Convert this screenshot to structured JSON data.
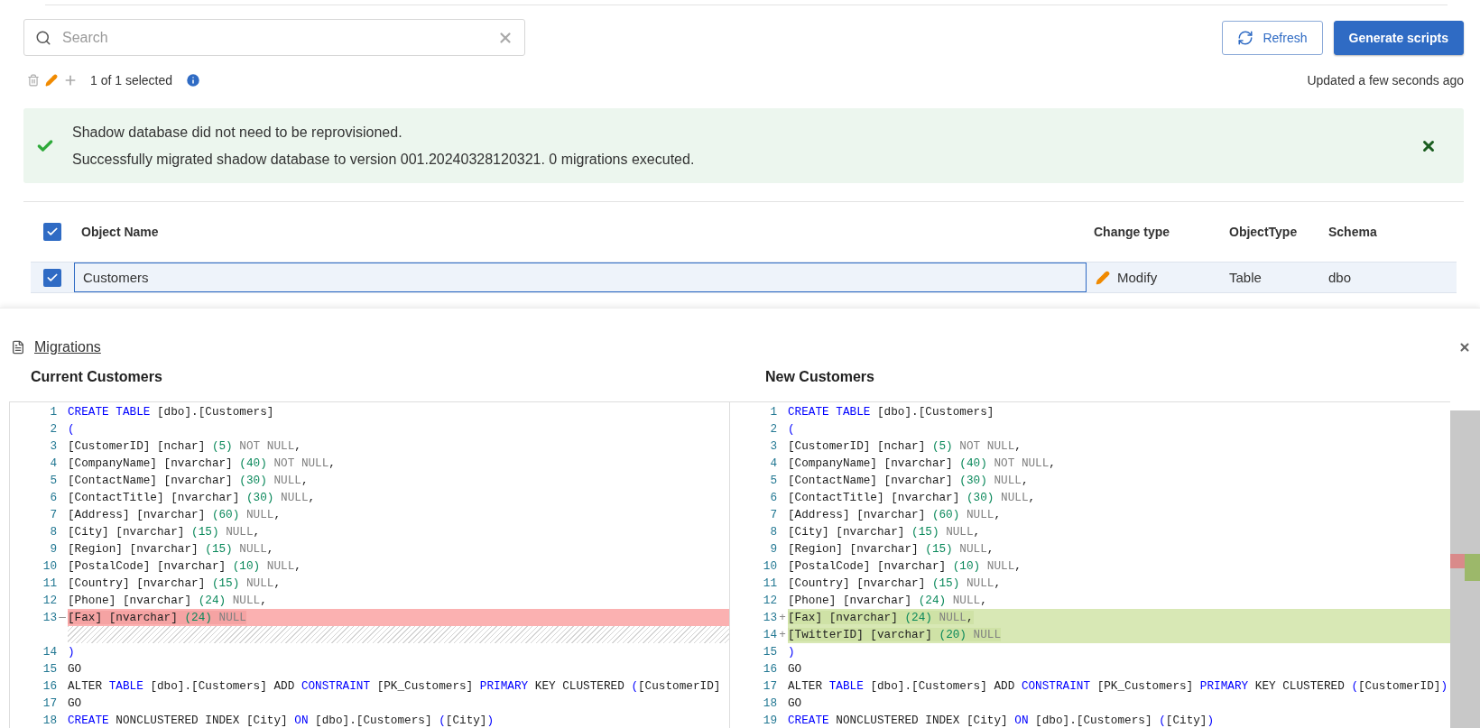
{
  "search": {
    "placeholder": "Search"
  },
  "buttons": [
    {
      "label": "Refresh",
      "kind": "secondary"
    },
    {
      "label": "Generate scripts",
      "kind": "primary"
    }
  ],
  "toolbar": {
    "selection": "1 of 1 selected",
    "updated": "Updated a few seconds ago",
    "delete_disabled": true,
    "add_disabled": true
  },
  "banner": {
    "messages": [
      "Shadow database did not need to be reprovisioned.",
      "Successfully migrated shadow database to version 001.20240328120321. 0 migrations executed."
    ]
  },
  "table": {
    "all_checked": true,
    "columns": [
      "Object Name",
      "Change type",
      "ObjectType",
      "Schema"
    ],
    "rows": [
      {
        "checked": true,
        "selected": true,
        "name": "Customers",
        "change_type": "Modify",
        "object_type": "Table",
        "schema": "dbo"
      }
    ]
  },
  "migrations": {
    "title": "Migrations",
    "panes": [
      {
        "title": "Current Customers",
        "lines": [
          {
            "kind": "normal",
            "number": "1",
            "tokens": [
              {
                "kind": "kw",
                "text": "CREATE TABLE"
              },
              {
                "kind": "id",
                "text": " [dbo].[Customers]"
              }
            ]
          },
          {
            "kind": "normal",
            "number": "2",
            "tokens": [
              {
                "kind": "kw",
                "text": "("
              }
            ]
          },
          {
            "kind": "normal",
            "number": "3",
            "tokens": [
              {
                "kind": "id",
                "text": "[CustomerID] [nchar] "
              },
              {
                "kind": "num",
                "text": "(5)"
              },
              {
                "kind": "null",
                "text": " NOT NULL"
              },
              {
                "kind": "id",
                "text": ","
              }
            ]
          },
          {
            "kind": "normal",
            "number": "4",
            "tokens": [
              {
                "kind": "id",
                "text": "[CompanyName] [nvarchar] "
              },
              {
                "kind": "num",
                "text": "(40)"
              },
              {
                "kind": "null",
                "text": " NOT NULL"
              },
              {
                "kind": "id",
                "text": ","
              }
            ]
          },
          {
            "kind": "normal",
            "number": "5",
            "tokens": [
              {
                "kind": "id",
                "text": "[ContactName] [nvarchar] "
              },
              {
                "kind": "num",
                "text": "(30)"
              },
              {
                "kind": "null",
                "text": " NULL"
              },
              {
                "kind": "id",
                "text": ","
              }
            ]
          },
          {
            "kind": "normal",
            "number": "6",
            "tokens": [
              {
                "kind": "id",
                "text": "[ContactTitle] [nvarchar] "
              },
              {
                "kind": "num",
                "text": "(30)"
              },
              {
                "kind": "null",
                "text": " NULL"
              },
              {
                "kind": "id",
                "text": ","
              }
            ]
          },
          {
            "kind": "normal",
            "number": "7",
            "tokens": [
              {
                "kind": "id",
                "text": "[Address] [nvarchar] "
              },
              {
                "kind": "num",
                "text": "(60)"
              },
              {
                "kind": "null",
                "text": " NULL"
              },
              {
                "kind": "id",
                "text": ","
              }
            ]
          },
          {
            "kind": "normal",
            "number": "8",
            "tokens": [
              {
                "kind": "id",
                "text": "[City] [nvarchar] "
              },
              {
                "kind": "num",
                "text": "(15)"
              },
              {
                "kind": "null",
                "text": " NULL"
              },
              {
                "kind": "id",
                "text": ","
              }
            ]
          },
          {
            "kind": "normal",
            "number": "9",
            "tokens": [
              {
                "kind": "id",
                "text": "[Region] [nvarchar] "
              },
              {
                "kind": "num",
                "text": "(15)"
              },
              {
                "kind": "null",
                "text": " NULL"
              },
              {
                "kind": "id",
                "text": ","
              }
            ]
          },
          {
            "kind": "normal",
            "number": "10",
            "tokens": [
              {
                "kind": "id",
                "text": "[PostalCode] [nvarchar] "
              },
              {
                "kind": "num",
                "text": "(10)"
              },
              {
                "kind": "null",
                "text": " NULL"
              },
              {
                "kind": "id",
                "text": ","
              }
            ]
          },
          {
            "kind": "normal",
            "number": "11",
            "tokens": [
              {
                "kind": "id",
                "text": "[Country] [nvarchar] "
              },
              {
                "kind": "num",
                "text": "(15)"
              },
              {
                "kind": "null",
                "text": " NULL"
              },
              {
                "kind": "id",
                "text": ","
              }
            ]
          },
          {
            "kind": "normal",
            "number": "12",
            "tokens": [
              {
                "kind": "id",
                "text": "[Phone] [nvarchar] "
              },
              {
                "kind": "num",
                "text": "(24)"
              },
              {
                "kind": "null",
                "text": " NULL"
              },
              {
                "kind": "id",
                "text": ","
              }
            ]
          },
          {
            "kind": "removed",
            "number": "13",
            "marker": "—",
            "tokens": [
              {
                "kind": "id",
                "text": "[Fax] [nvarchar] "
              },
              {
                "kind": "num",
                "text": "(24)"
              },
              {
                "kind": "null",
                "text": " NULL"
              }
            ]
          },
          {
            "kind": "filler"
          },
          {
            "kind": "normal",
            "number": "14",
            "tokens": [
              {
                "kind": "kw",
                "text": ")"
              }
            ]
          },
          {
            "kind": "normal",
            "number": "15",
            "tokens": [
              {
                "kind": "id",
                "text": "GO"
              }
            ]
          },
          {
            "kind": "normal",
            "number": "16",
            "tokens": [
              {
                "kind": "id",
                "text": "ALTER "
              },
              {
                "kind": "kw",
                "text": "TABLE"
              },
              {
                "kind": "id",
                "text": " [dbo].[Customers] ADD "
              },
              {
                "kind": "kw",
                "text": "CONSTRAINT"
              },
              {
                "kind": "id",
                "text": " [PK_Customers] "
              },
              {
                "kind": "kw",
                "text": "PRIMARY"
              },
              {
                "kind": "id",
                "text": " KEY CLUSTERED "
              },
              {
                "kind": "kw",
                "text": "("
              },
              {
                "kind": "id",
                "text": "[CustomerID]"
              }
            ]
          },
          {
            "kind": "normal",
            "number": "17",
            "tokens": [
              {
                "kind": "id",
                "text": "GO"
              }
            ]
          },
          {
            "kind": "normal",
            "number": "18",
            "tokens": [
              {
                "kind": "kw",
                "text": "CREATE"
              },
              {
                "kind": "id",
                "text": " NONCLUSTERED INDEX [City] "
              },
              {
                "kind": "kw",
                "text": "ON"
              },
              {
                "kind": "id",
                "text": " [dbo].[Customers] "
              },
              {
                "kind": "kw",
                "text": "("
              },
              {
                "kind": "id",
                "text": "[City]"
              },
              {
                "kind": "kw",
                "text": ")"
              }
            ]
          }
        ]
      },
      {
        "title": "New Customers",
        "lines": [
          {
            "kind": "normal",
            "number": "1",
            "tokens": [
              {
                "kind": "kw",
                "text": "CREATE TABLE"
              },
              {
                "kind": "id",
                "text": " [dbo].[Customers]"
              }
            ]
          },
          {
            "kind": "normal",
            "number": "2",
            "tokens": [
              {
                "kind": "kw",
                "text": "("
              }
            ]
          },
          {
            "kind": "normal",
            "number": "3",
            "tokens": [
              {
                "kind": "id",
                "text": "[CustomerID] [nchar] "
              },
              {
                "kind": "num",
                "text": "(5)"
              },
              {
                "kind": "null",
                "text": " NOT NULL"
              },
              {
                "kind": "id",
                "text": ","
              }
            ]
          },
          {
            "kind": "normal",
            "number": "4",
            "tokens": [
              {
                "kind": "id",
                "text": "[CompanyName] [nvarchar] "
              },
              {
                "kind": "num",
                "text": "(40)"
              },
              {
                "kind": "null",
                "text": " NOT NULL"
              },
              {
                "kind": "id",
                "text": ","
              }
            ]
          },
          {
            "kind": "normal",
            "number": "5",
            "tokens": [
              {
                "kind": "id",
                "text": "[ContactName] [nvarchar] "
              },
              {
                "kind": "num",
                "text": "(30)"
              },
              {
                "kind": "null",
                "text": " NULL"
              },
              {
                "kind": "id",
                "text": ","
              }
            ]
          },
          {
            "kind": "normal",
            "number": "6",
            "tokens": [
              {
                "kind": "id",
                "text": "[ContactTitle] [nvarchar] "
              },
              {
                "kind": "num",
                "text": "(30)"
              },
              {
                "kind": "null",
                "text": " NULL"
              },
              {
                "kind": "id",
                "text": ","
              }
            ]
          },
          {
            "kind": "normal",
            "number": "7",
            "tokens": [
              {
                "kind": "id",
                "text": "[Address] [nvarchar] "
              },
              {
                "kind": "num",
                "text": "(60)"
              },
              {
                "kind": "null",
                "text": " NULL"
              },
              {
                "kind": "id",
                "text": ","
              }
            ]
          },
          {
            "kind": "normal",
            "number": "8",
            "tokens": [
              {
                "kind": "id",
                "text": "[City] [nvarchar] "
              },
              {
                "kind": "num",
                "text": "(15)"
              },
              {
                "kind": "null",
                "text": " NULL"
              },
              {
                "kind": "id",
                "text": ","
              }
            ]
          },
          {
            "kind": "normal",
            "number": "9",
            "tokens": [
              {
                "kind": "id",
                "text": "[Region] [nvarchar] "
              },
              {
                "kind": "num",
                "text": "(15)"
              },
              {
                "kind": "null",
                "text": " NULL"
              },
              {
                "kind": "id",
                "text": ","
              }
            ]
          },
          {
            "kind": "normal",
            "number": "10",
            "tokens": [
              {
                "kind": "id",
                "text": "[PostalCode] [nvarchar] "
              },
              {
                "kind": "num",
                "text": "(10)"
              },
              {
                "kind": "null",
                "text": " NULL"
              },
              {
                "kind": "id",
                "text": ","
              }
            ]
          },
          {
            "kind": "normal",
            "number": "11",
            "tokens": [
              {
                "kind": "id",
                "text": "[Country] [nvarchar] "
              },
              {
                "kind": "num",
                "text": "(15)"
              },
              {
                "kind": "null",
                "text": " NULL"
              },
              {
                "kind": "id",
                "text": ","
              }
            ]
          },
          {
            "kind": "normal",
            "number": "12",
            "tokens": [
              {
                "kind": "id",
                "text": "[Phone] [nvarchar] "
              },
              {
                "kind": "num",
                "text": "(24)"
              },
              {
                "kind": "null",
                "text": " NULL"
              },
              {
                "kind": "id",
                "text": ","
              }
            ]
          },
          {
            "kind": "added",
            "number": "13",
            "marker": "+",
            "tokens": [
              {
                "kind": "id",
                "text": "[Fax] [nvarchar] "
              },
              {
                "kind": "num",
                "text": "(24)"
              },
              {
                "kind": "null",
                "text": " NULL"
              },
              {
                "kind": "id",
                "text": ","
              }
            ]
          },
          {
            "kind": "added",
            "number": "14",
            "marker": "+",
            "tokens": [
              {
                "kind": "id",
                "text": "[TwitterID] [varchar] "
              },
              {
                "kind": "num",
                "text": "(20)"
              },
              {
                "kind": "null",
                "text": " NULL"
              }
            ]
          },
          {
            "kind": "normal",
            "number": "15",
            "tokens": [
              {
                "kind": "kw",
                "text": ")"
              }
            ]
          },
          {
            "kind": "normal",
            "number": "16",
            "tokens": [
              {
                "kind": "id",
                "text": "GO"
              }
            ]
          },
          {
            "kind": "normal",
            "number": "17",
            "tokens": [
              {
                "kind": "id",
                "text": "ALTER "
              },
              {
                "kind": "kw",
                "text": "TABLE"
              },
              {
                "kind": "id",
                "text": " [dbo].[Customers] ADD "
              },
              {
                "kind": "kw",
                "text": "CONSTRAINT"
              },
              {
                "kind": "id",
                "text": " [PK_Customers] "
              },
              {
                "kind": "kw",
                "text": "PRIMARY"
              },
              {
                "kind": "id",
                "text": " KEY CLUSTERED "
              },
              {
                "kind": "kw",
                "text": "("
              },
              {
                "kind": "id",
                "text": "[CustomerID]"
              },
              {
                "kind": "kw",
                "text": ")"
              }
            ]
          },
          {
            "kind": "normal",
            "number": "18",
            "tokens": [
              {
                "kind": "id",
                "text": "GO"
              }
            ]
          },
          {
            "kind": "normal",
            "number": "19",
            "tokens": [
              {
                "kind": "kw",
                "text": "CREATE"
              },
              {
                "kind": "id",
                "text": " NONCLUSTERED INDEX [City] "
              },
              {
                "kind": "kw",
                "text": "ON"
              },
              {
                "kind": "id",
                "text": " [dbo].[Customers] "
              },
              {
                "kind": "kw",
                "text": "("
              },
              {
                "kind": "id",
                "text": "[City]"
              },
              {
                "kind": "kw",
                "text": ")"
              }
            ]
          }
        ]
      }
    ]
  }
}
